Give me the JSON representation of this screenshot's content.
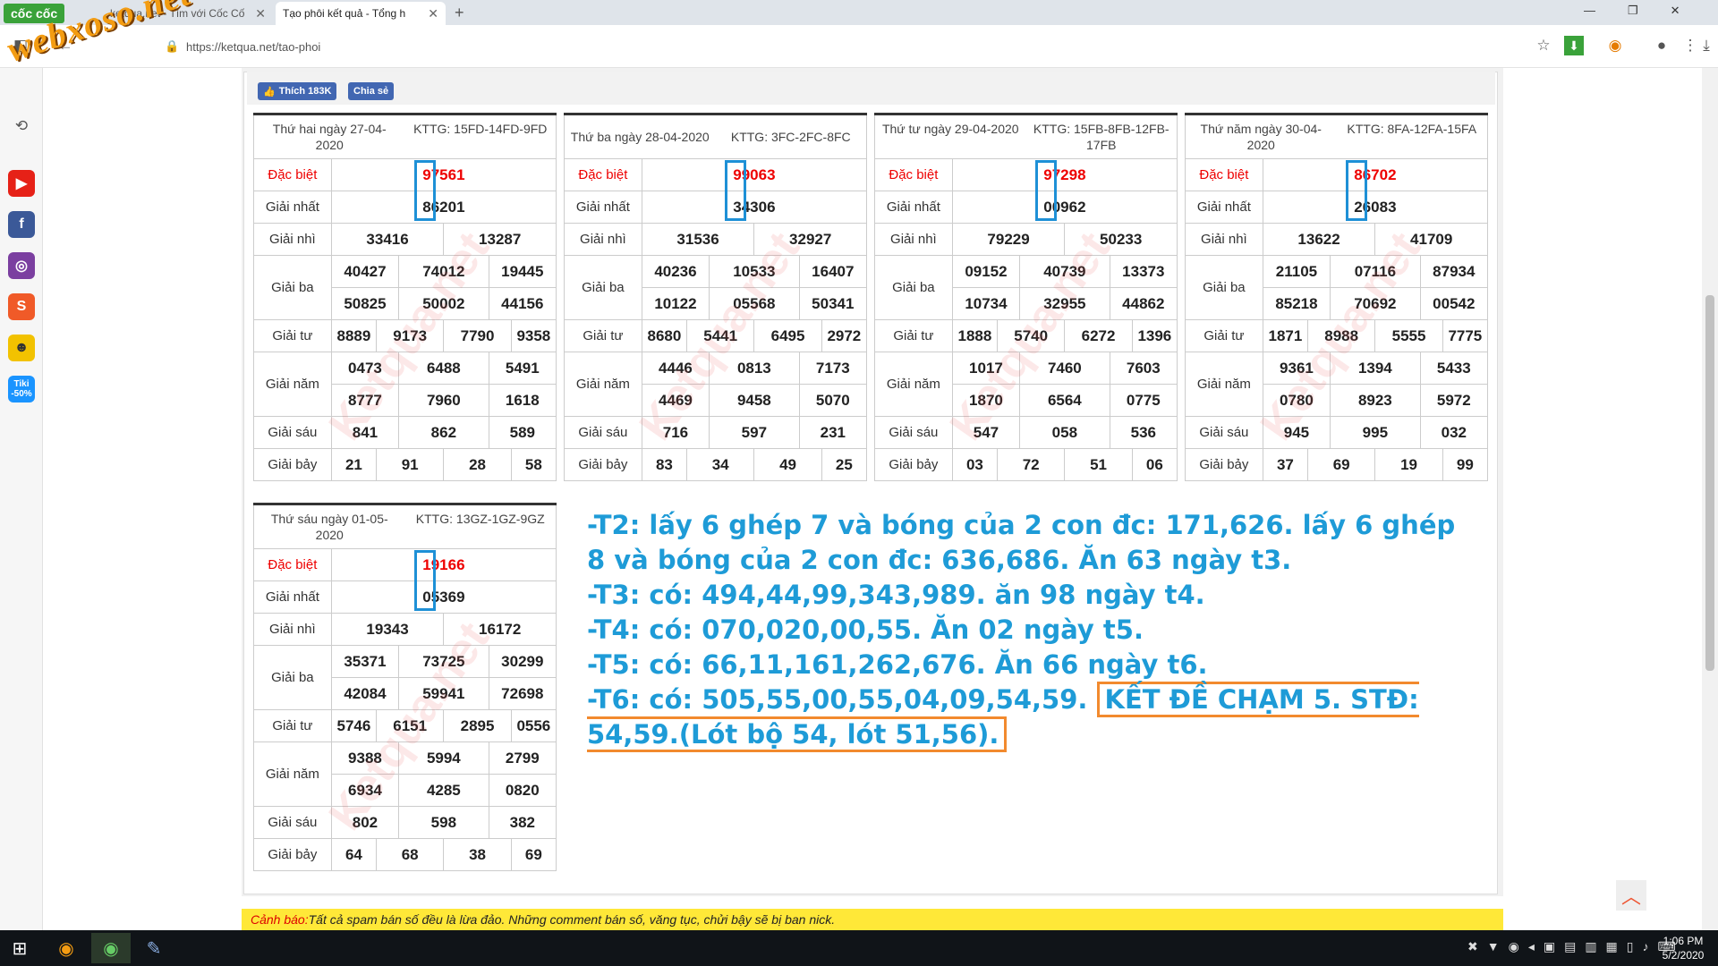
{
  "browser": {
    "brand": "cốc cốc",
    "tabs": [
      {
        "label": "ketqua.net - Tìm với Cốc Cốc"
      },
      {
        "label": "Tạo phôi kết quả - Tổng h"
      }
    ],
    "new_tab": "+",
    "url": "https://ketqua.net/tao-phoi",
    "watermark_logo": "webxoso.net"
  },
  "social": {
    "like_label": "Thích 183K",
    "share_label": "Chia sẻ"
  },
  "tables": [
    {
      "date": "Thứ hai ngày 27-04-2020",
      "kttg": "KTTG: 15FD-14FD-9FD",
      "db": "97561",
      "g1": "86201",
      "g2": [
        "33416",
        "13287"
      ],
      "g3": [
        "40427",
        "74012",
        "19445",
        "50825",
        "50002",
        "44156"
      ],
      "g4": [
        "8889",
        "9173",
        "7790",
        "9358"
      ],
      "g5": [
        "0473",
        "6488",
        "5491",
        "8777",
        "7960",
        "1618"
      ],
      "g6": [
        "841",
        "862",
        "589"
      ],
      "g7": [
        "21",
        "91",
        "28",
        "58"
      ]
    },
    {
      "date": "Thứ ba ngày 28-04-2020",
      "kttg": "KTTG: 3FC-2FC-8FC",
      "db": "99063",
      "g1": "34306",
      "g2": [
        "31536",
        "32927"
      ],
      "g3": [
        "40236",
        "10533",
        "16407",
        "10122",
        "05568",
        "50341"
      ],
      "g4": [
        "8680",
        "5441",
        "6495",
        "2972"
      ],
      "g5": [
        "4446",
        "0813",
        "7173",
        "4469",
        "9458",
        "5070"
      ],
      "g6": [
        "716",
        "597",
        "231"
      ],
      "g7": [
        "83",
        "34",
        "49",
        "25"
      ]
    },
    {
      "date": "Thứ tư ngày 29-04-2020",
      "kttg": "KTTG: 15FB-8FB-12FB-17FB",
      "db": "97298",
      "g1": "00962",
      "g2": [
        "79229",
        "50233"
      ],
      "g3": [
        "09152",
        "40739",
        "13373",
        "10734",
        "32955",
        "44862"
      ],
      "g4": [
        "1888",
        "5740",
        "6272",
        "1396"
      ],
      "g5": [
        "1017",
        "7460",
        "7603",
        "1870",
        "6564",
        "0775"
      ],
      "g6": [
        "547",
        "058",
        "536"
      ],
      "g7": [
        "03",
        "72",
        "51",
        "06"
      ]
    },
    {
      "date": "Thứ năm ngày 30-04-2020",
      "kttg": "KTTG: 8FA-12FA-15FA",
      "db": "86702",
      "g1": "26083",
      "g2": [
        "13622",
        "41709"
      ],
      "g3": [
        "21105",
        "07116",
        "87934",
        "85218",
        "70692",
        "00542"
      ],
      "g4": [
        "1871",
        "8988",
        "5555",
        "7775"
      ],
      "g5": [
        "9361",
        "1394",
        "5433",
        "0780",
        "8923",
        "5972"
      ],
      "g6": [
        "945",
        "995",
        "032"
      ],
      "g7": [
        "37",
        "69",
        "19",
        "99"
      ]
    },
    {
      "date": "Thứ sáu ngày 01-05-2020",
      "kttg": "KTTG: 13GZ-1GZ-9GZ",
      "db": "19166",
      "g1": "05369",
      "g2": [
        "19343",
        "16172"
      ],
      "g3": [
        "35371",
        "73725",
        "30299",
        "42084",
        "59941",
        "72698"
      ],
      "g4": [
        "5746",
        "6151",
        "2895",
        "0556"
      ],
      "g5": [
        "9388",
        "5994",
        "2799",
        "6934",
        "4285",
        "0820"
      ],
      "g6": [
        "802",
        "598",
        "382"
      ],
      "g7": [
        "64",
        "68",
        "38",
        "69"
      ]
    }
  ],
  "labels": {
    "db": "Đặc biệt",
    "g1": "Giải nhất",
    "g2": "Giải nhì",
    "g3": "Giải ba",
    "g4": "Giải tư",
    "g5": "Giải năm",
    "g6": "Giải sáu",
    "g7": "Giải bảy"
  },
  "table_watermark": "Ketqua.net",
  "notes": {
    "l1": "-T2: lấy 6 ghép 7 và bóng của 2 con đc: 171,626. lấy 6 ghép 8 và bóng của 2 con đc: 636,686. Ăn 63 ngày t3.",
    "l2": "-T3: có: 494,44,99,343,989. ăn 98 ngày t4.",
    "l3": "-T4: có: 070,020,00,55. Ăn 02 ngày t5.",
    "l4": "-T5: có: 66,11,161,262,676. Ăn 66 ngày t6.",
    "l5": "-T6: có: 505,55,00,55,04,09,54,59.",
    "l5_box": "KẾT ĐỀ CHẠM 5. STĐ: 54,59.(Lót bộ 54, lót 51,56)."
  },
  "warning": {
    "label": "Cảnh báo:",
    "text": " Tất cả spam bán số đều là lừa đảo. Những comment bán số, văng tục, chửi bậy sẽ bị ban nick."
  },
  "sidebar_tiki": "Tiki -50%",
  "clock": {
    "time": "1:06 PM",
    "date": "5/2/2020"
  }
}
